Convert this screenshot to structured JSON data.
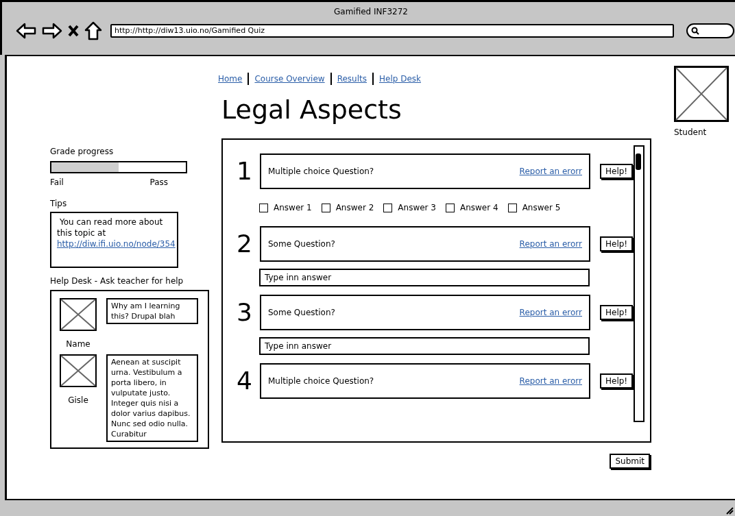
{
  "window": {
    "title": "Gamified INF3272"
  },
  "browser": {
    "url": "http://http://diw13.uio.no/Gamified Quiz"
  },
  "nav": [
    {
      "label": "Home"
    },
    {
      "label": "Course Overview"
    },
    {
      "label": "Results"
    },
    {
      "label": "Help Desk"
    }
  ],
  "page_title": "Legal Aspects",
  "grade_progress": {
    "label": "Grade progress",
    "level": 0.5,
    "min_label": "Fail",
    "max_label": "Pass"
  },
  "tips": {
    "label": "Tips",
    "text": "You can read more about this topic at",
    "link": "http://diw.ifi.uio.no/node/354"
  },
  "help_desk": {
    "label": "Help Desk - Ask teacher for help",
    "messages": [
      {
        "name": "Name",
        "text": "Why am I learning this? Drupal blah"
      },
      {
        "name": "Gisle",
        "text": "Aenean at suscipit urna. Vestibulum a porta libero, in vulputate justo. Integer quis nisi a dolor varius dapibus. Nunc sed odio nulla. Curabitur"
      }
    ]
  },
  "questions": [
    {
      "number": "1",
      "kind": "choice",
      "text": "Multiple choice Question?",
      "report": "Report an erorr",
      "help": "Help!",
      "answers": [
        {
          "label": "Answer 1",
          "checked": false
        },
        {
          "label": "Answer 2",
          "checked": false
        },
        {
          "label": "Answer 3",
          "checked": false
        },
        {
          "label": "Answer 4",
          "checked": false
        },
        {
          "label": "Answer 5",
          "checked": false
        }
      ]
    },
    {
      "number": "2",
      "kind": "text",
      "text": "Some Question?",
      "report": "Report an erorr",
      "help": "Help!",
      "placeholder": "Type inn answer"
    },
    {
      "number": "3",
      "kind": "text",
      "text": "Some Question?",
      "report": "Report an erorr",
      "help": "Help!",
      "placeholder": "Type inn answer"
    },
    {
      "number": "4",
      "kind": "choice",
      "text": "Multiple choice Question?",
      "report": "Report an erorr",
      "help": "Help!"
    }
  ],
  "submit": "Submit",
  "user": {
    "name": "Student"
  }
}
